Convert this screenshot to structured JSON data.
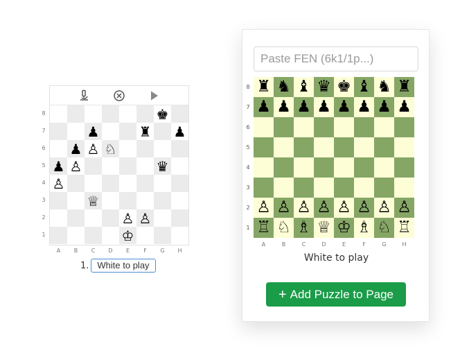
{
  "left_puzzle": {
    "toolbar": [
      {
        "name": "analyze-icon",
        "glyph": "🔬"
      },
      {
        "name": "clear-icon",
        "glyph": "⊗"
      },
      {
        "name": "play-icon",
        "glyph": "▶"
      }
    ],
    "rank_labels": [
      "8",
      "7",
      "6",
      "5",
      "4",
      "3",
      "2",
      "1"
    ],
    "file_labels": [
      "A",
      "B",
      "C",
      "D",
      "E",
      "F",
      "G",
      "H"
    ],
    "board": [
      [
        "",
        "",
        "",
        "",
        "",
        "",
        "k",
        ""
      ],
      [
        "",
        "",
        "p",
        "",
        "",
        "r",
        "",
        "p"
      ],
      [
        "",
        "p",
        "P",
        "N",
        "",
        "",
        "",
        ""
      ],
      [
        "p",
        "P",
        "",
        "",
        "",
        "",
        "q",
        ""
      ],
      [
        "P",
        "",
        "",
        "",
        "",
        "",
        "",
        ""
      ],
      [
        "",
        "",
        "Q",
        "",
        "",
        "",
        "",
        ""
      ],
      [
        "",
        "",
        "",
        "",
        "P",
        "P",
        "",
        ""
      ],
      [
        "",
        "",
        "",
        "",
        "K",
        "",
        "",
        ""
      ]
    ],
    "move_number": "1.",
    "move_text": "White to play"
  },
  "editor": {
    "fen_placeholder": "Paste FEN (6k1/1p...)",
    "rank_labels": [
      "8",
      "7",
      "6",
      "5",
      "4",
      "3",
      "2",
      "1"
    ],
    "file_labels": [
      "A",
      "B",
      "C",
      "D",
      "E",
      "F",
      "G",
      "H"
    ],
    "board": [
      [
        "r",
        "n",
        "b",
        "q",
        "k",
        "b",
        "n",
        "r"
      ],
      [
        "p",
        "p",
        "p",
        "p",
        "p",
        "p",
        "p",
        "p"
      ],
      [
        "",
        "",
        "",
        "",
        "",
        "",
        "",
        ""
      ],
      [
        "",
        "",
        "",
        "",
        "",
        "",
        "",
        ""
      ],
      [
        "",
        "",
        "",
        "",
        "",
        "",
        "",
        ""
      ],
      [
        "",
        "",
        "",
        "",
        "",
        "",
        "",
        ""
      ],
      [
        "P",
        "P",
        "P",
        "P",
        "P",
        "P",
        "P",
        "P"
      ],
      [
        "R",
        "N",
        "B",
        "Q",
        "K",
        "B",
        "N",
        "R"
      ]
    ],
    "to_play": "White to play",
    "add_button_plus": "+",
    "add_button_label": "Add Puzzle to Page",
    "colors": {
      "light": "#fdfed6",
      "dark": "#86a666",
      "button": "#1b9c48"
    }
  }
}
